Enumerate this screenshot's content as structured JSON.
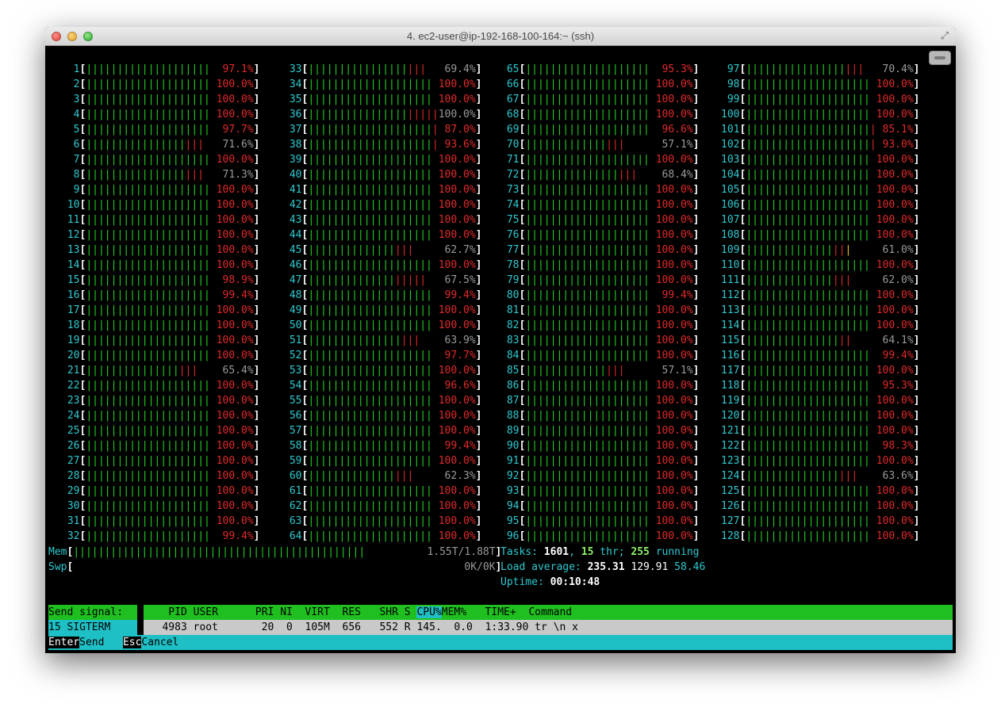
{
  "window": {
    "title": "4. ec2-user@ip-192-168-100-164:~ (ssh)",
    "fullscreen_icon": "⤢"
  },
  "colors": {
    "green_bar": "#24d024",
    "red_bar": "#e02a2a",
    "cyan": "#2ec9d0",
    "header_green": "#1fbf1f",
    "header_cyan": "#1fc0c5"
  },
  "cpus": [
    {
      "id": "1",
      "pct": "97.1%",
      "green": 20,
      "red": 0
    },
    {
      "id": "2",
      "pct": "100.0%",
      "green": 20,
      "red": 0
    },
    {
      "id": "3",
      "pct": "100.0%",
      "green": 20,
      "red": 0
    },
    {
      "id": "4",
      "pct": "100.0%",
      "green": 20,
      "red": 0
    },
    {
      "id": "5",
      "pct": "97.7%",
      "green": 20,
      "red": 0
    },
    {
      "id": "6",
      "pct": "71.6%",
      "green": 16,
      "red": 3
    },
    {
      "id": "7",
      "pct": "100.0%",
      "green": 20,
      "red": 0
    },
    {
      "id": "8",
      "pct": "71.3%",
      "green": 16,
      "red": 3
    },
    {
      "id": "9",
      "pct": "100.0%",
      "green": 20,
      "red": 0
    },
    {
      "id": "10",
      "pct": "100.0%",
      "green": 20,
      "red": 0
    },
    {
      "id": "11",
      "pct": "100.0%",
      "green": 20,
      "red": 0
    },
    {
      "id": "12",
      "pct": "100.0%",
      "green": 20,
      "red": 0
    },
    {
      "id": "13",
      "pct": "100.0%",
      "green": 20,
      "red": 0
    },
    {
      "id": "14",
      "pct": "100.0%",
      "green": 20,
      "red": 0
    },
    {
      "id": "15",
      "pct": "98.9%",
      "green": 20,
      "red": 0
    },
    {
      "id": "16",
      "pct": "99.4%",
      "green": 20,
      "red": 0
    },
    {
      "id": "17",
      "pct": "100.0%",
      "green": 20,
      "red": 0
    },
    {
      "id": "18",
      "pct": "100.0%",
      "green": 20,
      "red": 0
    },
    {
      "id": "19",
      "pct": "100.0%",
      "green": 20,
      "red": 0
    },
    {
      "id": "20",
      "pct": "100.0%",
      "green": 20,
      "red": 0
    },
    {
      "id": "21",
      "pct": "65.4%",
      "green": 15,
      "red": 3
    },
    {
      "id": "22",
      "pct": "100.0%",
      "green": 20,
      "red": 0
    },
    {
      "id": "23",
      "pct": "100.0%",
      "green": 20,
      "red": 0
    },
    {
      "id": "24",
      "pct": "100.0%",
      "green": 20,
      "red": 0
    },
    {
      "id": "25",
      "pct": "100.0%",
      "green": 20,
      "red": 0
    },
    {
      "id": "26",
      "pct": "100.0%",
      "green": 20,
      "red": 0
    },
    {
      "id": "27",
      "pct": "100.0%",
      "green": 20,
      "red": 0
    },
    {
      "id": "28",
      "pct": "100.0%",
      "green": 20,
      "red": 0
    },
    {
      "id": "29",
      "pct": "100.0%",
      "green": 20,
      "red": 0
    },
    {
      "id": "30",
      "pct": "100.0%",
      "green": 20,
      "red": 0
    },
    {
      "id": "31",
      "pct": "100.0%",
      "green": 20,
      "red": 0
    },
    {
      "id": "32",
      "pct": "99.4%",
      "green": 20,
      "red": 0
    },
    {
      "id": "33",
      "pct": "69.4%",
      "green": 16,
      "red": 3
    },
    {
      "id": "34",
      "pct": "100.0%",
      "green": 20,
      "red": 0
    },
    {
      "id": "35",
      "pct": "100.0%",
      "green": 20,
      "red": 0
    },
    {
      "id": "36",
      "pct": "100.0%",
      "green": 16,
      "red": 5
    },
    {
      "id": "37",
      "pct": "87.0%",
      "green": 20,
      "red": 1
    },
    {
      "id": "38",
      "pct": "93.6%",
      "green": 20,
      "red": 1
    },
    {
      "id": "39",
      "pct": "100.0%",
      "green": 20,
      "red": 0
    },
    {
      "id": "40",
      "pct": "100.0%",
      "green": 20,
      "red": 0
    },
    {
      "id": "41",
      "pct": "100.0%",
      "green": 20,
      "red": 0
    },
    {
      "id": "42",
      "pct": "100.0%",
      "green": 20,
      "red": 0
    },
    {
      "id": "43",
      "pct": "100.0%",
      "green": 20,
      "red": 0
    },
    {
      "id": "44",
      "pct": "100.0%",
      "green": 20,
      "red": 0
    },
    {
      "id": "45",
      "pct": "62.7%",
      "green": 14,
      "red": 3
    },
    {
      "id": "46",
      "pct": "100.0%",
      "green": 20,
      "red": 0
    },
    {
      "id": "47",
      "pct": "67.5%",
      "green": 14,
      "red": 5
    },
    {
      "id": "48",
      "pct": "99.4%",
      "green": 20,
      "red": 0
    },
    {
      "id": "49",
      "pct": "100.0%",
      "green": 20,
      "red": 0
    },
    {
      "id": "50",
      "pct": "100.0%",
      "green": 20,
      "red": 0
    },
    {
      "id": "51",
      "pct": "63.9%",
      "green": 15,
      "red": 3
    },
    {
      "id": "52",
      "pct": "97.7%",
      "green": 20,
      "red": 0
    },
    {
      "id": "53",
      "pct": "100.0%",
      "green": 20,
      "red": 0
    },
    {
      "id": "54",
      "pct": "96.6%",
      "green": 20,
      "red": 0
    },
    {
      "id": "55",
      "pct": "100.0%",
      "green": 20,
      "red": 0
    },
    {
      "id": "56",
      "pct": "100.0%",
      "green": 20,
      "red": 0
    },
    {
      "id": "57",
      "pct": "100.0%",
      "green": 20,
      "red": 0
    },
    {
      "id": "58",
      "pct": "99.4%",
      "green": 20,
      "red": 0
    },
    {
      "id": "59",
      "pct": "100.0%",
      "green": 20,
      "red": 0
    },
    {
      "id": "60",
      "pct": "62.3%",
      "green": 14,
      "red": 3
    },
    {
      "id": "61",
      "pct": "100.0%",
      "green": 20,
      "red": 0
    },
    {
      "id": "62",
      "pct": "100.0%",
      "green": 20,
      "red": 0
    },
    {
      "id": "63",
      "pct": "100.0%",
      "green": 20,
      "red": 0
    },
    {
      "id": "64",
      "pct": "100.0%",
      "green": 20,
      "red": 0
    },
    {
      "id": "65",
      "pct": "95.3%",
      "green": 20,
      "red": 0
    },
    {
      "id": "66",
      "pct": "100.0%",
      "green": 20,
      "red": 0
    },
    {
      "id": "67",
      "pct": "100.0%",
      "green": 20,
      "red": 0
    },
    {
      "id": "68",
      "pct": "100.0%",
      "green": 20,
      "red": 0
    },
    {
      "id": "69",
      "pct": "96.6%",
      "green": 20,
      "red": 0
    },
    {
      "id": "70",
      "pct": "57.1%",
      "green": 13,
      "red": 3
    },
    {
      "id": "71",
      "pct": "100.0%",
      "green": 20,
      "red": 0
    },
    {
      "id": "72",
      "pct": "68.4%",
      "green": 15,
      "red": 3
    },
    {
      "id": "73",
      "pct": "100.0%",
      "green": 20,
      "red": 0
    },
    {
      "id": "74",
      "pct": "100.0%",
      "green": 20,
      "red": 0
    },
    {
      "id": "75",
      "pct": "100.0%",
      "green": 20,
      "red": 0
    },
    {
      "id": "76",
      "pct": "100.0%",
      "green": 20,
      "red": 0
    },
    {
      "id": "77",
      "pct": "100.0%",
      "green": 20,
      "red": 0
    },
    {
      "id": "78",
      "pct": "100.0%",
      "green": 20,
      "red": 0
    },
    {
      "id": "79",
      "pct": "100.0%",
      "green": 20,
      "red": 0
    },
    {
      "id": "80",
      "pct": "99.4%",
      "green": 20,
      "red": 0
    },
    {
      "id": "81",
      "pct": "100.0%",
      "green": 20,
      "red": 0
    },
    {
      "id": "82",
      "pct": "100.0%",
      "green": 20,
      "red": 0
    },
    {
      "id": "83",
      "pct": "100.0%",
      "green": 20,
      "red": 0
    },
    {
      "id": "84",
      "pct": "100.0%",
      "green": 20,
      "red": 0
    },
    {
      "id": "85",
      "pct": "57.1%",
      "green": 13,
      "red": 3
    },
    {
      "id": "86",
      "pct": "100.0%",
      "green": 20,
      "red": 0
    },
    {
      "id": "87",
      "pct": "100.0%",
      "green": 20,
      "red": 0
    },
    {
      "id": "88",
      "pct": "100.0%",
      "green": 20,
      "red": 0
    },
    {
      "id": "89",
      "pct": "100.0%",
      "green": 20,
      "red": 0
    },
    {
      "id": "90",
      "pct": "100.0%",
      "green": 20,
      "red": 0
    },
    {
      "id": "91",
      "pct": "100.0%",
      "green": 20,
      "red": 0
    },
    {
      "id": "92",
      "pct": "100.0%",
      "green": 20,
      "red": 0
    },
    {
      "id": "93",
      "pct": "100.0%",
      "green": 20,
      "red": 0
    },
    {
      "id": "94",
      "pct": "100.0%",
      "green": 20,
      "red": 0
    },
    {
      "id": "95",
      "pct": "100.0%",
      "green": 20,
      "red": 0
    },
    {
      "id": "96",
      "pct": "100.0%",
      "green": 20,
      "red": 0
    },
    {
      "id": "97",
      "pct": "70.4%",
      "green": 16,
      "red": 3
    },
    {
      "id": "98",
      "pct": "100.0%",
      "green": 20,
      "red": 0
    },
    {
      "id": "99",
      "pct": "100.0%",
      "green": 20,
      "red": 0
    },
    {
      "id": "100",
      "pct": "100.0%",
      "green": 20,
      "red": 0
    },
    {
      "id": "101",
      "pct": "85.1%",
      "green": 20,
      "red": 1
    },
    {
      "id": "102",
      "pct": "93.0%",
      "green": 20,
      "red": 1
    },
    {
      "id": "103",
      "pct": "100.0%",
      "green": 20,
      "red": 0
    },
    {
      "id": "104",
      "pct": "100.0%",
      "green": 20,
      "red": 0
    },
    {
      "id": "105",
      "pct": "100.0%",
      "green": 20,
      "red": 0
    },
    {
      "id": "106",
      "pct": "100.0%",
      "green": 20,
      "red": 0
    },
    {
      "id": "107",
      "pct": "100.0%",
      "green": 20,
      "red": 0
    },
    {
      "id": "108",
      "pct": "100.0%",
      "green": 20,
      "red": 0
    },
    {
      "id": "109",
      "pct": "61.0%",
      "green": 14,
      "red": 2,
      "yellow": 1
    },
    {
      "id": "110",
      "pct": "100.0%",
      "green": 20,
      "red": 0
    },
    {
      "id": "111",
      "pct": "62.0%",
      "green": 14,
      "red": 3
    },
    {
      "id": "112",
      "pct": "100.0%",
      "green": 20,
      "red": 0
    },
    {
      "id": "113",
      "pct": "100.0%",
      "green": 20,
      "red": 0
    },
    {
      "id": "114",
      "pct": "100.0%",
      "green": 20,
      "red": 0
    },
    {
      "id": "115",
      "pct": "64.1%",
      "green": 15,
      "red": 2
    },
    {
      "id": "116",
      "pct": "99.4%",
      "green": 20,
      "red": 0
    },
    {
      "id": "117",
      "pct": "100.0%",
      "green": 20,
      "red": 0
    },
    {
      "id": "118",
      "pct": "95.3%",
      "green": 20,
      "red": 0
    },
    {
      "id": "119",
      "pct": "100.0%",
      "green": 20,
      "red": 0
    },
    {
      "id": "120",
      "pct": "100.0%",
      "green": 20,
      "red": 0
    },
    {
      "id": "121",
      "pct": "100.0%",
      "green": 20,
      "red": 0
    },
    {
      "id": "122",
      "pct": "98.3%",
      "green": 20,
      "red": 0
    },
    {
      "id": "123",
      "pct": "100.0%",
      "green": 20,
      "red": 0
    },
    {
      "id": "124",
      "pct": "63.6%",
      "green": 15,
      "red": 3
    },
    {
      "id": "125",
      "pct": "100.0%",
      "green": 20,
      "red": 0
    },
    {
      "id": "126",
      "pct": "100.0%",
      "green": 20,
      "red": 0
    },
    {
      "id": "127",
      "pct": "100.0%",
      "green": 20,
      "red": 0
    },
    {
      "id": "128",
      "pct": "100.0%",
      "green": 20,
      "red": 0
    }
  ],
  "mem": {
    "label": "Mem",
    "value": "1.55T/1.88T",
    "fraction": 0.82
  },
  "swp": {
    "label": "Swp",
    "value": "0K/0K"
  },
  "tasks": {
    "label": "Tasks: ",
    "count": "1601",
    "sep1": ", ",
    "thr": "15",
    "thr_label": " thr; ",
    "running": "255",
    "running_label": " running"
  },
  "load": {
    "label": "Load average: ",
    "v1": "235.31",
    "v5": "129.91",
    "v15": "58.46"
  },
  "uptime": {
    "label": "Uptime: ",
    "value": "00:10:48"
  },
  "signal_panel": {
    "title": "Send signal:",
    "selected": "15 SIGTERM"
  },
  "process_header": {
    "pid": "PID",
    "user": "USER",
    "pri": "PRI",
    "ni": "NI",
    "virt": "VIRT",
    "res": "RES",
    "shr": "SHR",
    "s": "S",
    "cpu": "CPU%",
    "mem": "MEM%",
    "time": "TIME+",
    "command": "Command"
  },
  "process_row": {
    "pid": "4983",
    "user": "root",
    "pri": "20",
    "ni": "0",
    "virt": "105M",
    "res": "656",
    "shr": "552",
    "s": "R",
    "cpu": "145.",
    "mem": "0.0",
    "time": "1:33.90",
    "command": "tr \\n x"
  },
  "footer": [
    {
      "key": "Enter",
      "label": "Send"
    },
    {
      "key": "Esc",
      "label": "Cancel"
    }
  ]
}
